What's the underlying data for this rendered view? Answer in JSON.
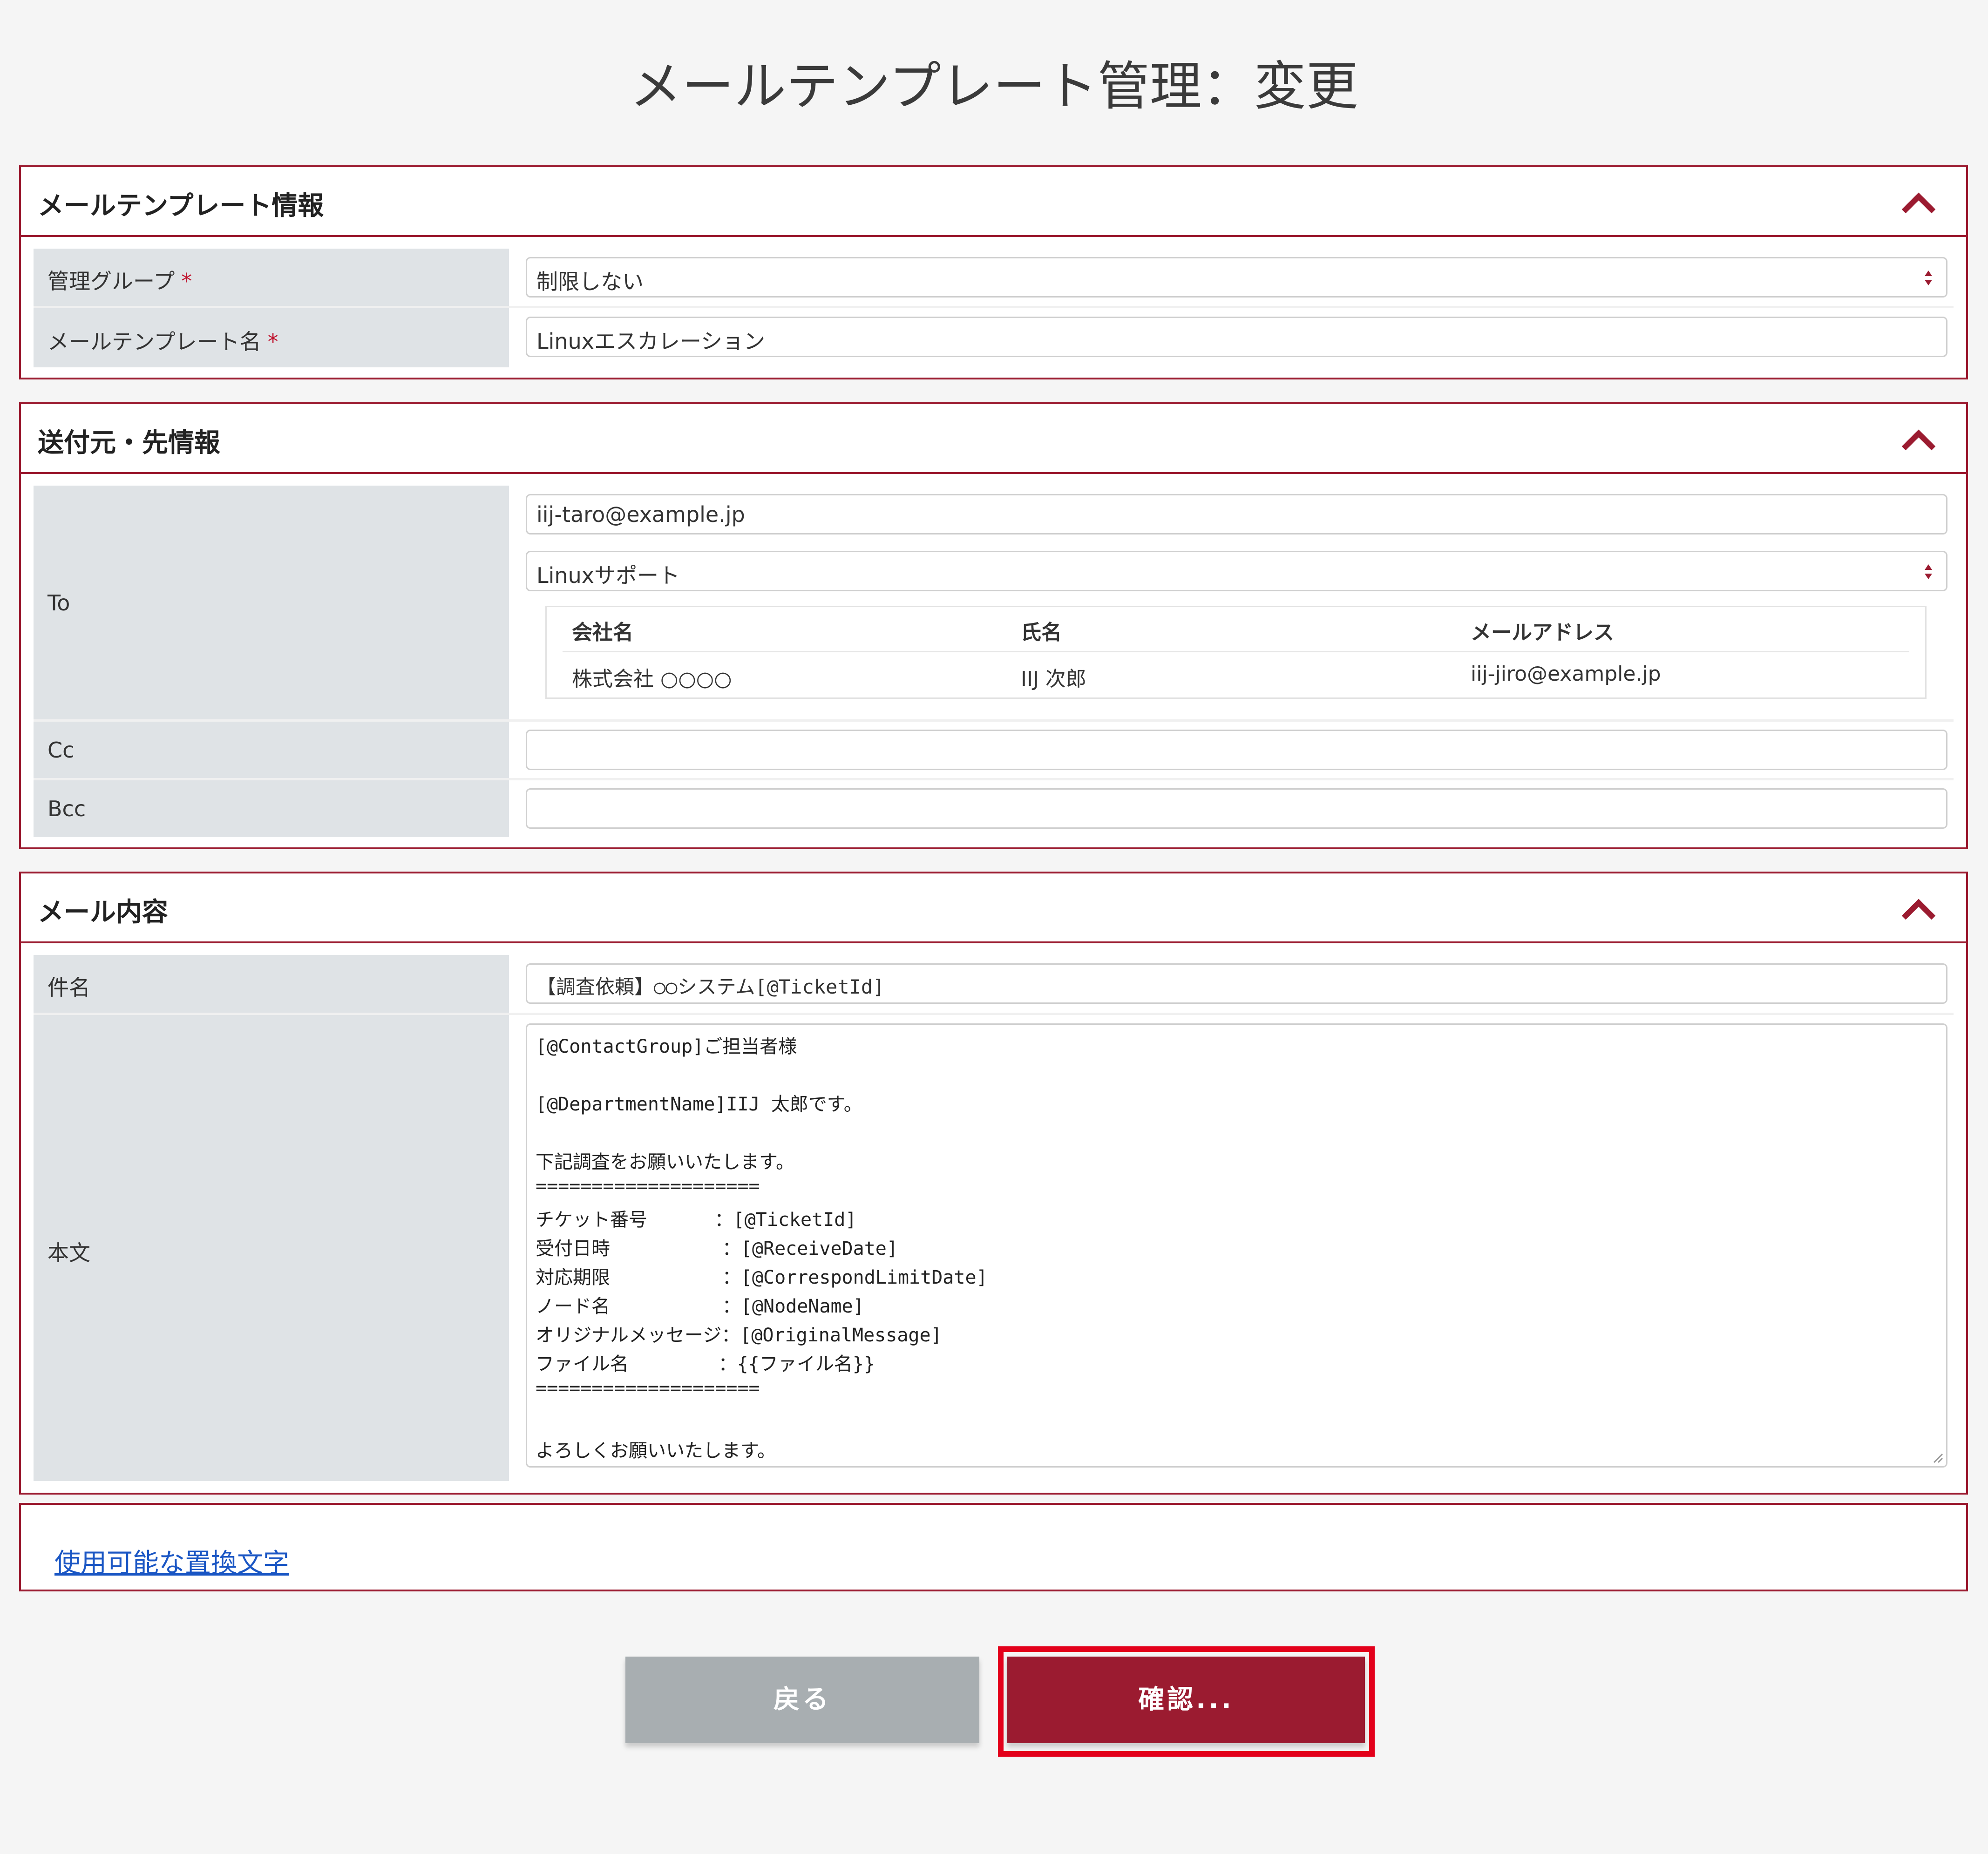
{
  "page": {
    "title": "メールテンプレート管理：変更"
  },
  "sections": {
    "template_info": {
      "title": "メールテンプレート情報",
      "fields": {
        "group_label": "管理グループ",
        "group_value": "制限しない",
        "name_label": "メールテンプレート名",
        "name_value": "Linuxエスカレーション",
        "required_mark": "*"
      }
    },
    "address_info": {
      "title": "送付元・先情報",
      "to_label": "To",
      "to_value": "iij-taro@example.jp",
      "to_group_value": "Linuxサポート",
      "contacts": {
        "headers": [
          "会社名",
          "氏名",
          "メールアドレス"
        ],
        "rows": [
          [
            "株式会社 ○○○○",
            "IIJ 次郎",
            "iij-jiro@example.jp"
          ]
        ]
      },
      "cc_label": "Cc",
      "cc_value": "",
      "bcc_label": "Bcc",
      "bcc_value": ""
    },
    "mail_content": {
      "title": "メール内容",
      "subject_label": "件名",
      "subject_value": "【調査依頼】○○システム[@TicketId]",
      "body_label": "本文",
      "body_lines": [
        "[@ContactGroup]ご担当者様",
        "",
        "[@DepartmentName]IIJ 太郎です。",
        "",
        "下記調査をお願いいたします。",
        "====================",
        "チケット番号      ：[@TicketId]",
        "受付日時          ：[@ReceiveDate]",
        "対応期限          ：[@CorrespondLimitDate]",
        "ノード名          ：[@NodeName]",
        "オリジナルメッセージ：[@OriginalMessage]",
        "ファイル名        ：{{ファイル名}}",
        "====================",
        "",
        "よろしくお願いいたします。"
      ]
    }
  },
  "replacement_link": "使用可能な置換文字",
  "buttons": {
    "back": "戻る",
    "confirm": "確認..."
  },
  "colors": {
    "accent": "#9b1b30",
    "highlight": "#e3001b",
    "label_bg": "#dfe3e6",
    "button_gray": "#a8aeb1"
  },
  "icons": {
    "collapse": "chevron-up-icon",
    "select": "sort-arrows-icon"
  }
}
